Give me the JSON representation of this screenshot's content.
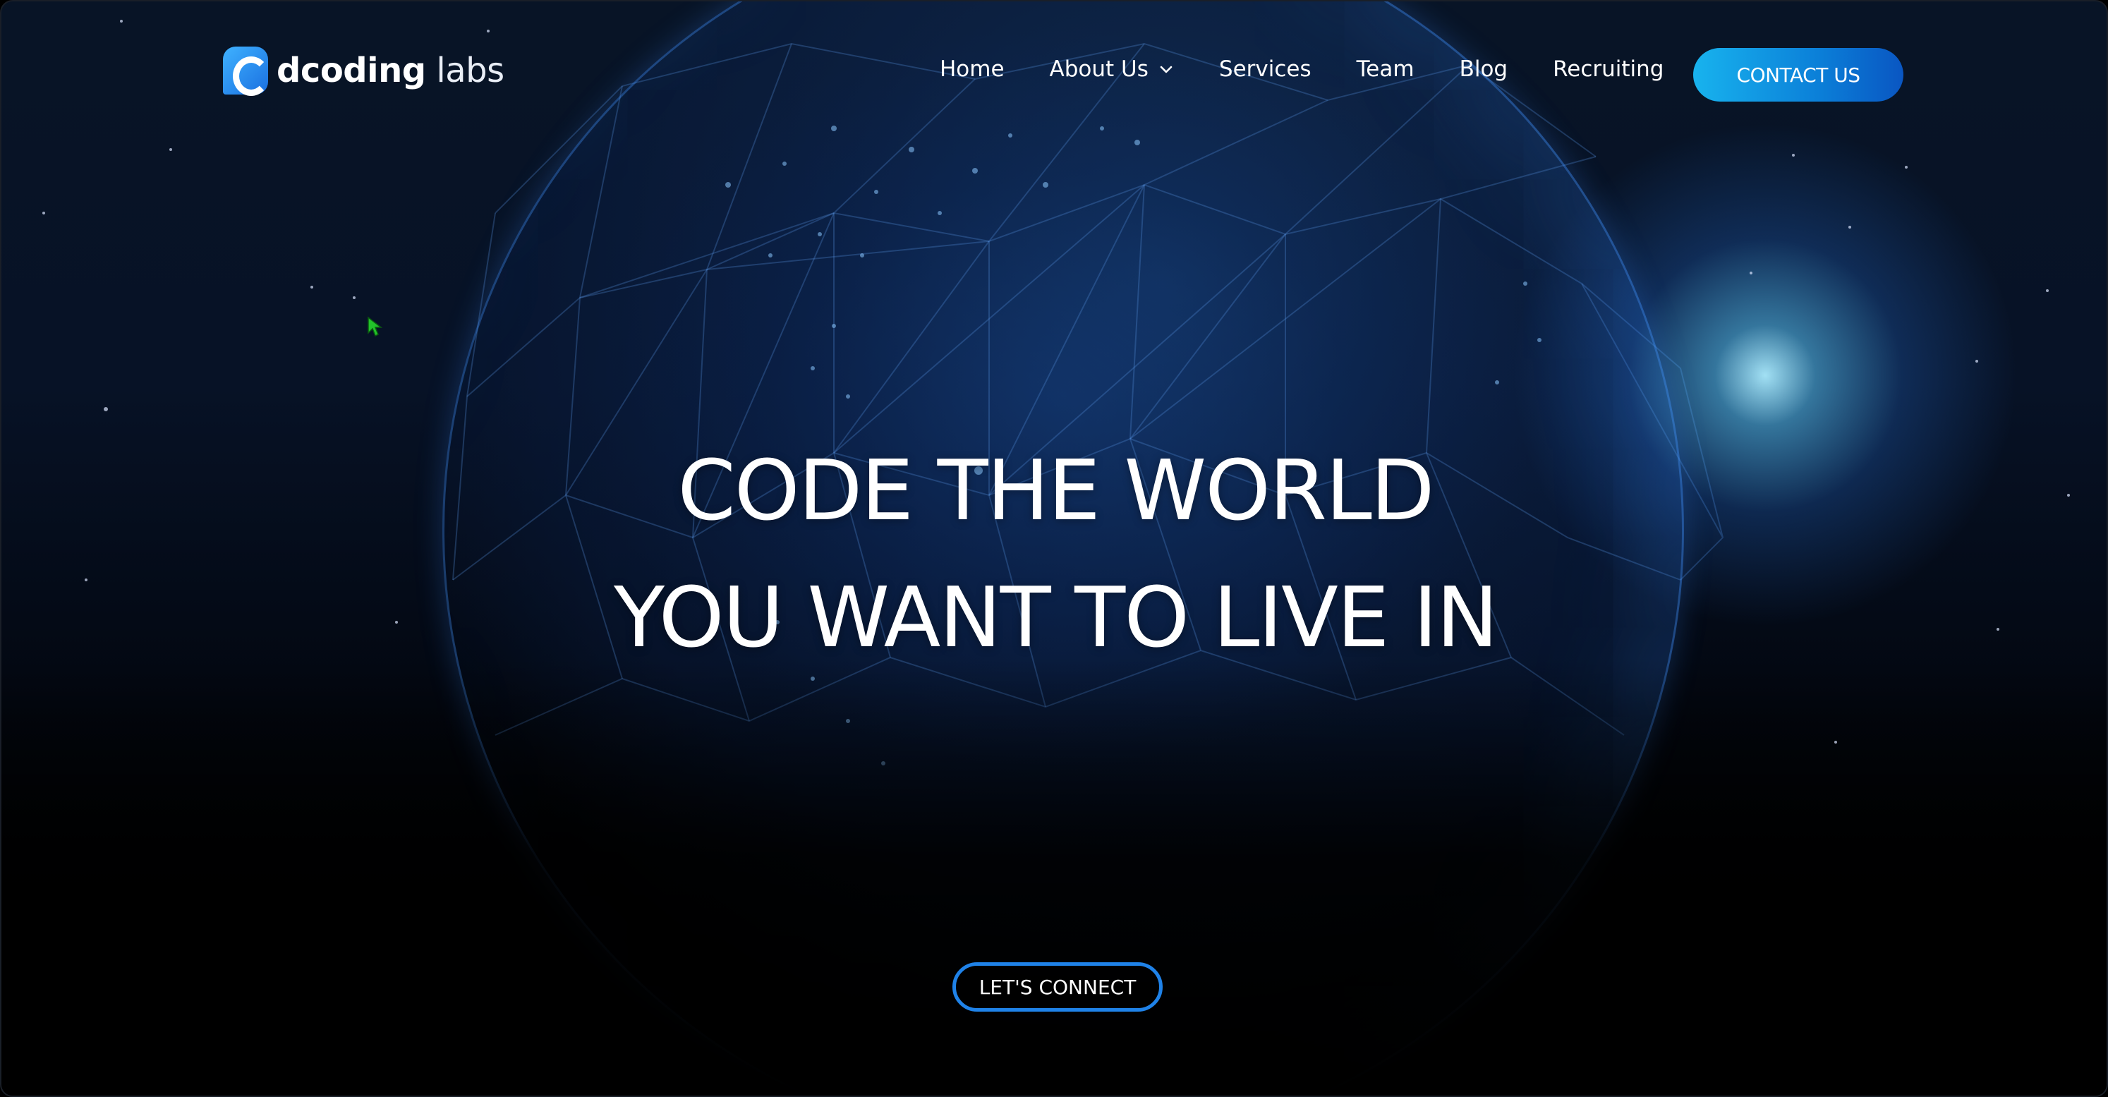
{
  "logo": {
    "bold": "dcoding",
    "light": " labs"
  },
  "nav": {
    "items": [
      {
        "label": "Home"
      },
      {
        "label": "About Us",
        "has_dropdown": true
      },
      {
        "label": "Services"
      },
      {
        "label": "Team"
      },
      {
        "label": "Blog"
      },
      {
        "label": "Recruiting"
      }
    ],
    "contact_label": "CONTACT US"
  },
  "hero": {
    "line1": "CODE THE WORLD",
    "line2": "YOU WANT TO LIVE IN",
    "cta_label": "LET'S CONNECT"
  },
  "colors": {
    "accent": "#1a8de6",
    "background": "#030812",
    "cursor": "#22c22a"
  },
  "icons": [
    "chevron-down-icon",
    "cursor-icon"
  ]
}
